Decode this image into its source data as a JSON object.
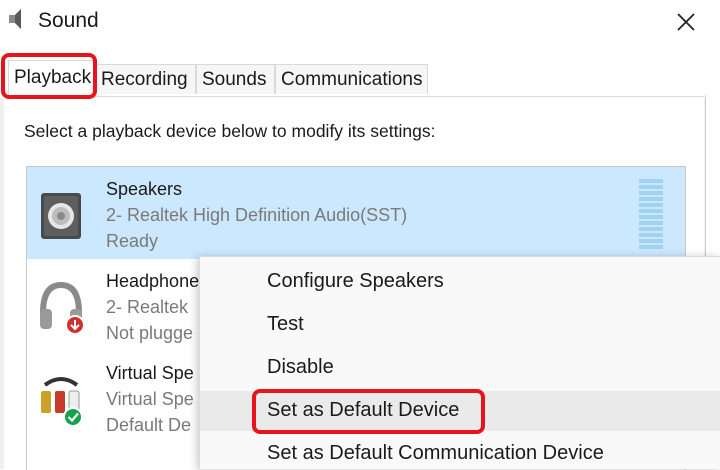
{
  "window": {
    "title": "Sound"
  },
  "tabs": [
    {
      "label": "Playback",
      "active": true
    },
    {
      "label": "Recording",
      "active": false
    },
    {
      "label": "Sounds",
      "active": false
    },
    {
      "label": "Communications",
      "active": false
    }
  ],
  "playback": {
    "instruction": "Select a playback device below to modify its settings:",
    "devices": [
      {
        "name": "Speakers",
        "description": "2- Realtek High Definition Audio(SST)",
        "status": "Ready",
        "icon": "speaker-icon",
        "selected": true
      },
      {
        "name": "Headphone",
        "description": "2- Realtek",
        "status": "Not plugge",
        "icon": "headphones-icon",
        "selected": false
      },
      {
        "name": "Virtual Spe",
        "description": "Virtual Spe",
        "status": "Default De",
        "icon": "virtual-speaker-icon",
        "selected": false
      }
    ]
  },
  "context_menu": {
    "items": [
      {
        "label": "Configure Speakers"
      },
      {
        "label": "Test"
      },
      {
        "label": "Disable"
      },
      {
        "label": "Set as Default Device",
        "highlighted": true
      },
      {
        "label": "Set as Default Communication Device"
      }
    ]
  },
  "colors": {
    "selection": "#cce8ff",
    "highlight_box": "#e8141c",
    "status_ok": "#16a34a",
    "status_unplugged": "#d0312d"
  }
}
